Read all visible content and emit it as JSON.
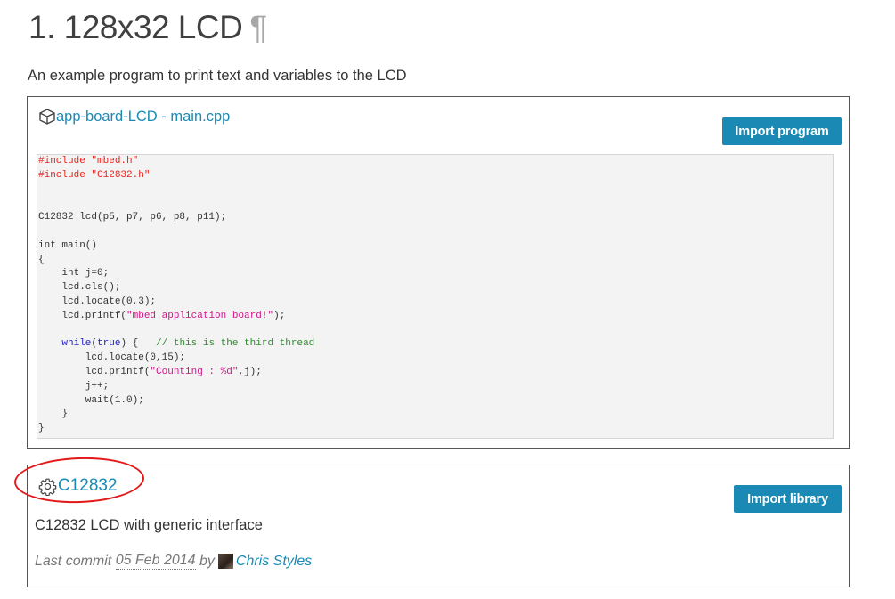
{
  "heading": {
    "title": "1. 128x32 LCD",
    "pilcrow": "¶"
  },
  "intro": "An example program to print text and variables to the LCD",
  "program": {
    "title": "app-board-LCD - main.cpp",
    "icon": "box-icon",
    "import_label": "Import program",
    "code": [
      [
        {
          "t": "#include \"mbed.h\"",
          "c": "pp"
        }
      ],
      [
        {
          "t": "#include \"C12832.h\"",
          "c": "pp"
        }
      ],
      [],
      [],
      [
        {
          "t": "C12832 lcd(p5, p7, p6, p8, p11);",
          "c": ""
        }
      ],
      [],
      [
        {
          "t": "int main()",
          "c": ""
        }
      ],
      [
        {
          "t": "{",
          "c": ""
        }
      ],
      [
        {
          "t": "    int j=0;",
          "c": ""
        }
      ],
      [
        {
          "t": "    lcd.cls();",
          "c": ""
        }
      ],
      [
        {
          "t": "    lcd.locate(0,3);",
          "c": ""
        }
      ],
      [
        {
          "t": "    lcd.printf(",
          "c": ""
        },
        {
          "t": "\"mbed application board!\"",
          "c": "str"
        },
        {
          "t": ");",
          "c": ""
        }
      ],
      [],
      [
        {
          "t": "    ",
          "c": ""
        },
        {
          "t": "while",
          "c": "kw"
        },
        {
          "t": "(",
          "c": ""
        },
        {
          "t": "true",
          "c": "kw"
        },
        {
          "t": ") {   ",
          "c": ""
        },
        {
          "t": "// this is the third thread",
          "c": "cm"
        }
      ],
      [
        {
          "t": "        lcd.locate(0,15);",
          "c": ""
        }
      ],
      [
        {
          "t": "        lcd.printf(",
          "c": ""
        },
        {
          "t": "\"Counting : %d\"",
          "c": "str"
        },
        {
          "t": ",j);",
          "c": ""
        }
      ],
      [
        {
          "t": "        j++;",
          "c": ""
        }
      ],
      [
        {
          "t": "        wait(1.0);",
          "c": ""
        }
      ],
      [
        {
          "t": "    }",
          "c": ""
        }
      ],
      [
        {
          "t": "}",
          "c": ""
        }
      ]
    ]
  },
  "library": {
    "name": "C12832",
    "icon": "gear-icon",
    "import_label": "Import library",
    "description": "C12832 LCD with generic interface",
    "commit_prefix": "Last commit ",
    "commit_date": "05 Feb 2014",
    "commit_by": " by",
    "author": "Chris Styles"
  },
  "colors": {
    "accent": "#1a8ab5",
    "annotation": "#e31818"
  }
}
